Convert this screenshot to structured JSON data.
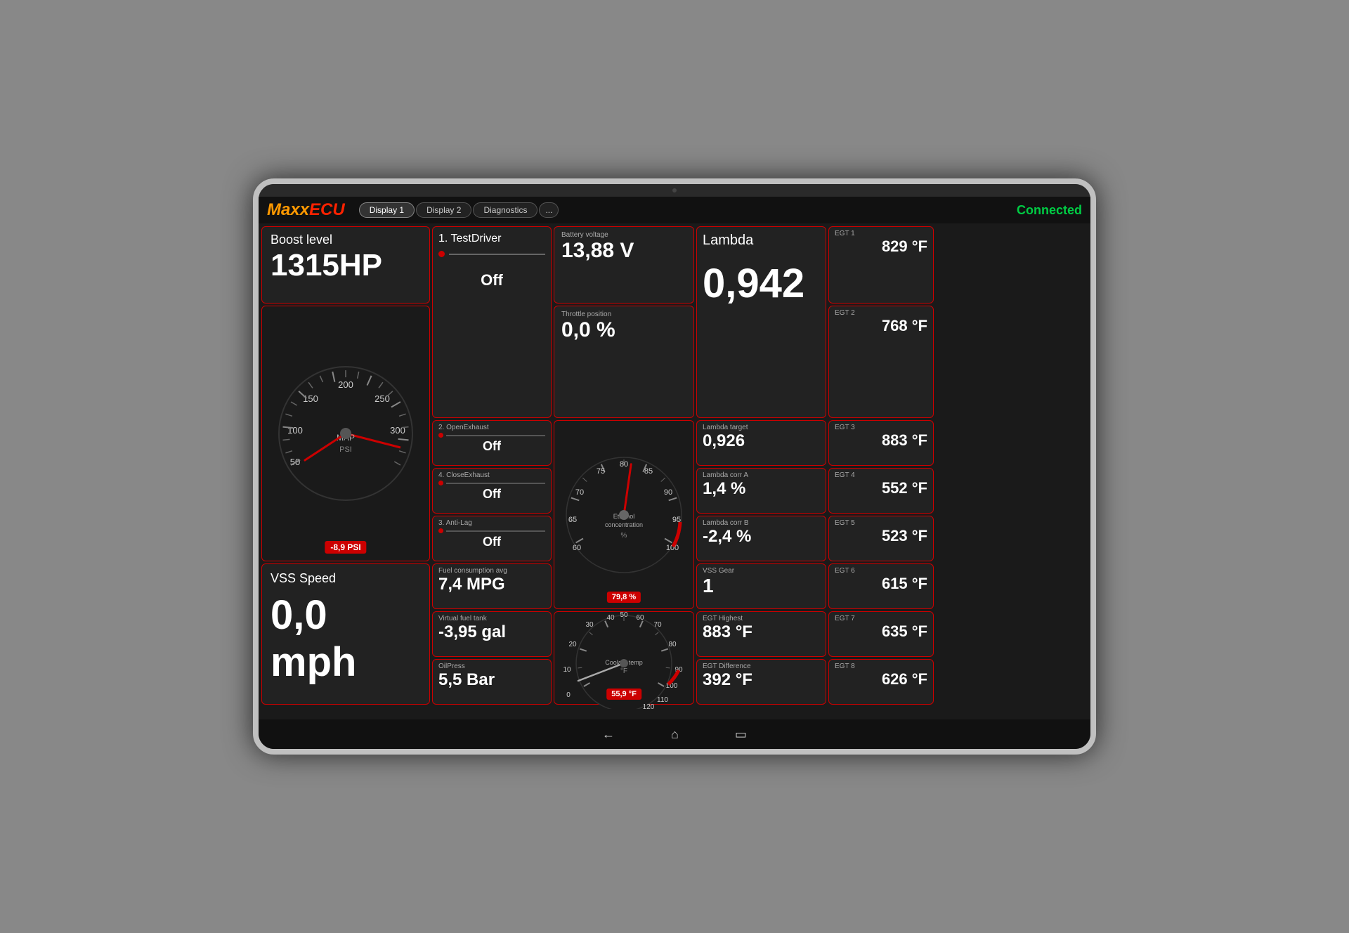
{
  "app": {
    "logo_maxx": "Maxx",
    "logo_ecu": "ECU",
    "connected": "Connected"
  },
  "tabs": [
    {
      "label": "Display 1",
      "active": true
    },
    {
      "label": "Display 2",
      "active": false
    },
    {
      "label": "Diagnostics",
      "active": false
    },
    {
      "label": "...",
      "active": false
    }
  ],
  "boost": {
    "title": "Boost level",
    "value": "1315HP"
  },
  "psi_gauge": {
    "value": "-8,9 PSI",
    "center_label": "MAP",
    "unit": "PSI"
  },
  "vss_speed": {
    "title": "VSS Speed",
    "value": "0,0 mph"
  },
  "testdriver": {
    "title": "1. TestDriver",
    "value": "Off"
  },
  "openexhaust": {
    "title": "2. OpenExhaust",
    "value": "Off"
  },
  "closeexhaust": {
    "title": "4. CloseExhaust",
    "value": "Off"
  },
  "antilag": {
    "title": "3. Anti-Lag",
    "value": "Off"
  },
  "fuel_consumption": {
    "label": "Fuel consumption avg",
    "value": "7,4 MPG"
  },
  "virtual_fuel": {
    "label": "Virtual fuel tank",
    "value": "-3,95 gal"
  },
  "oil_press": {
    "label": "OilPress",
    "value": "5,5 Bar"
  },
  "battery": {
    "label": "Battery voltage",
    "value": "13,88 V"
  },
  "throttle": {
    "label": "Throttle position",
    "value": "0,0 %"
  },
  "ethanol": {
    "label": "Ethanol concentration",
    "unit": "%",
    "value": "79,8 %"
  },
  "coolant": {
    "label": "Coolant temp",
    "unit": "°F",
    "value": "55,9 °F"
  },
  "lambda": {
    "title": "Lambda",
    "value": "0,942"
  },
  "lambda_target": {
    "label": "Lambda target",
    "value": "0,926"
  },
  "lambda_corr_a": {
    "label": "Lambda corr A",
    "value": "1,4 %"
  },
  "lambda_corr_b": {
    "label": "Lambda corr B",
    "value": "-2,4 %"
  },
  "vss_gear": {
    "label": "VSS Gear",
    "value": "1"
  },
  "egt_highest": {
    "label": "EGT Highest",
    "value": "883 °F"
  },
  "egt_difference": {
    "label": "EGT Difference",
    "value": "392 °F"
  },
  "egt": [
    {
      "label": "EGT 1",
      "value": "829 °F"
    },
    {
      "label": "EGT 2",
      "value": "768 °F"
    },
    {
      "label": "EGT 3",
      "value": "883 °F"
    },
    {
      "label": "EGT 4",
      "value": "552 °F"
    },
    {
      "label": "EGT 5",
      "value": "523 °F"
    },
    {
      "label": "EGT 6",
      "value": "615 °F"
    },
    {
      "label": "EGT 7",
      "value": "635 °F"
    },
    {
      "label": "EGT 8",
      "value": "626 °F"
    }
  ],
  "nav": {
    "back": "←",
    "home": "⌂",
    "recents": "▭"
  }
}
